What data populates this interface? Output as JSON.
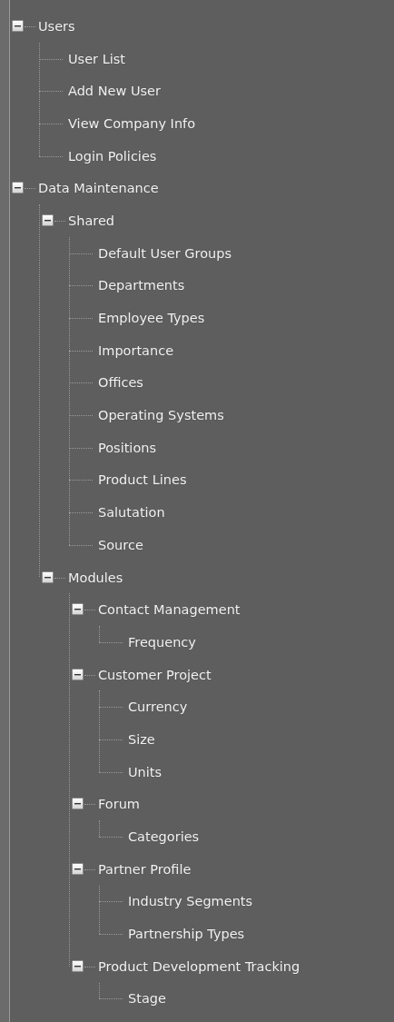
{
  "tree": [
    {
      "label": "Users",
      "expanded": true,
      "children": [
        {
          "label": "User List"
        },
        {
          "label": "Add New User"
        },
        {
          "label": "View Company Info"
        },
        {
          "label": "Login Policies"
        }
      ]
    },
    {
      "label": "Data Maintenance",
      "expanded": true,
      "children": [
        {
          "label": "Shared",
          "expanded": true,
          "children": [
            {
              "label": "Default User Groups"
            },
            {
              "label": "Departments"
            },
            {
              "label": "Employee Types"
            },
            {
              "label": "Importance"
            },
            {
              "label": "Offices"
            },
            {
              "label": "Operating Systems"
            },
            {
              "label": "Positions"
            },
            {
              "label": "Product Lines"
            },
            {
              "label": "Salutation"
            },
            {
              "label": "Source"
            }
          ]
        },
        {
          "label": "Modules",
          "expanded": true,
          "children": [
            {
              "label": "Contact Management",
              "expanded": true,
              "children": [
                {
                  "label": "Frequency"
                }
              ]
            },
            {
              "label": "Customer Project",
              "expanded": true,
              "children": [
                {
                  "label": "Currency"
                },
                {
                  "label": "Size"
                },
                {
                  "label": "Units"
                }
              ]
            },
            {
              "label": "Forum",
              "expanded": true,
              "children": [
                {
                  "label": "Categories"
                }
              ]
            },
            {
              "label": "Partner Profile",
              "expanded": true,
              "children": [
                {
                  "label": "Industry Segments"
                },
                {
                  "label": "Partnership Types"
                }
              ]
            },
            {
              "label": "Product Development Tracking",
              "expanded": true,
              "children": [
                {
                  "label": "Stage"
                }
              ]
            }
          ]
        }
      ]
    }
  ]
}
